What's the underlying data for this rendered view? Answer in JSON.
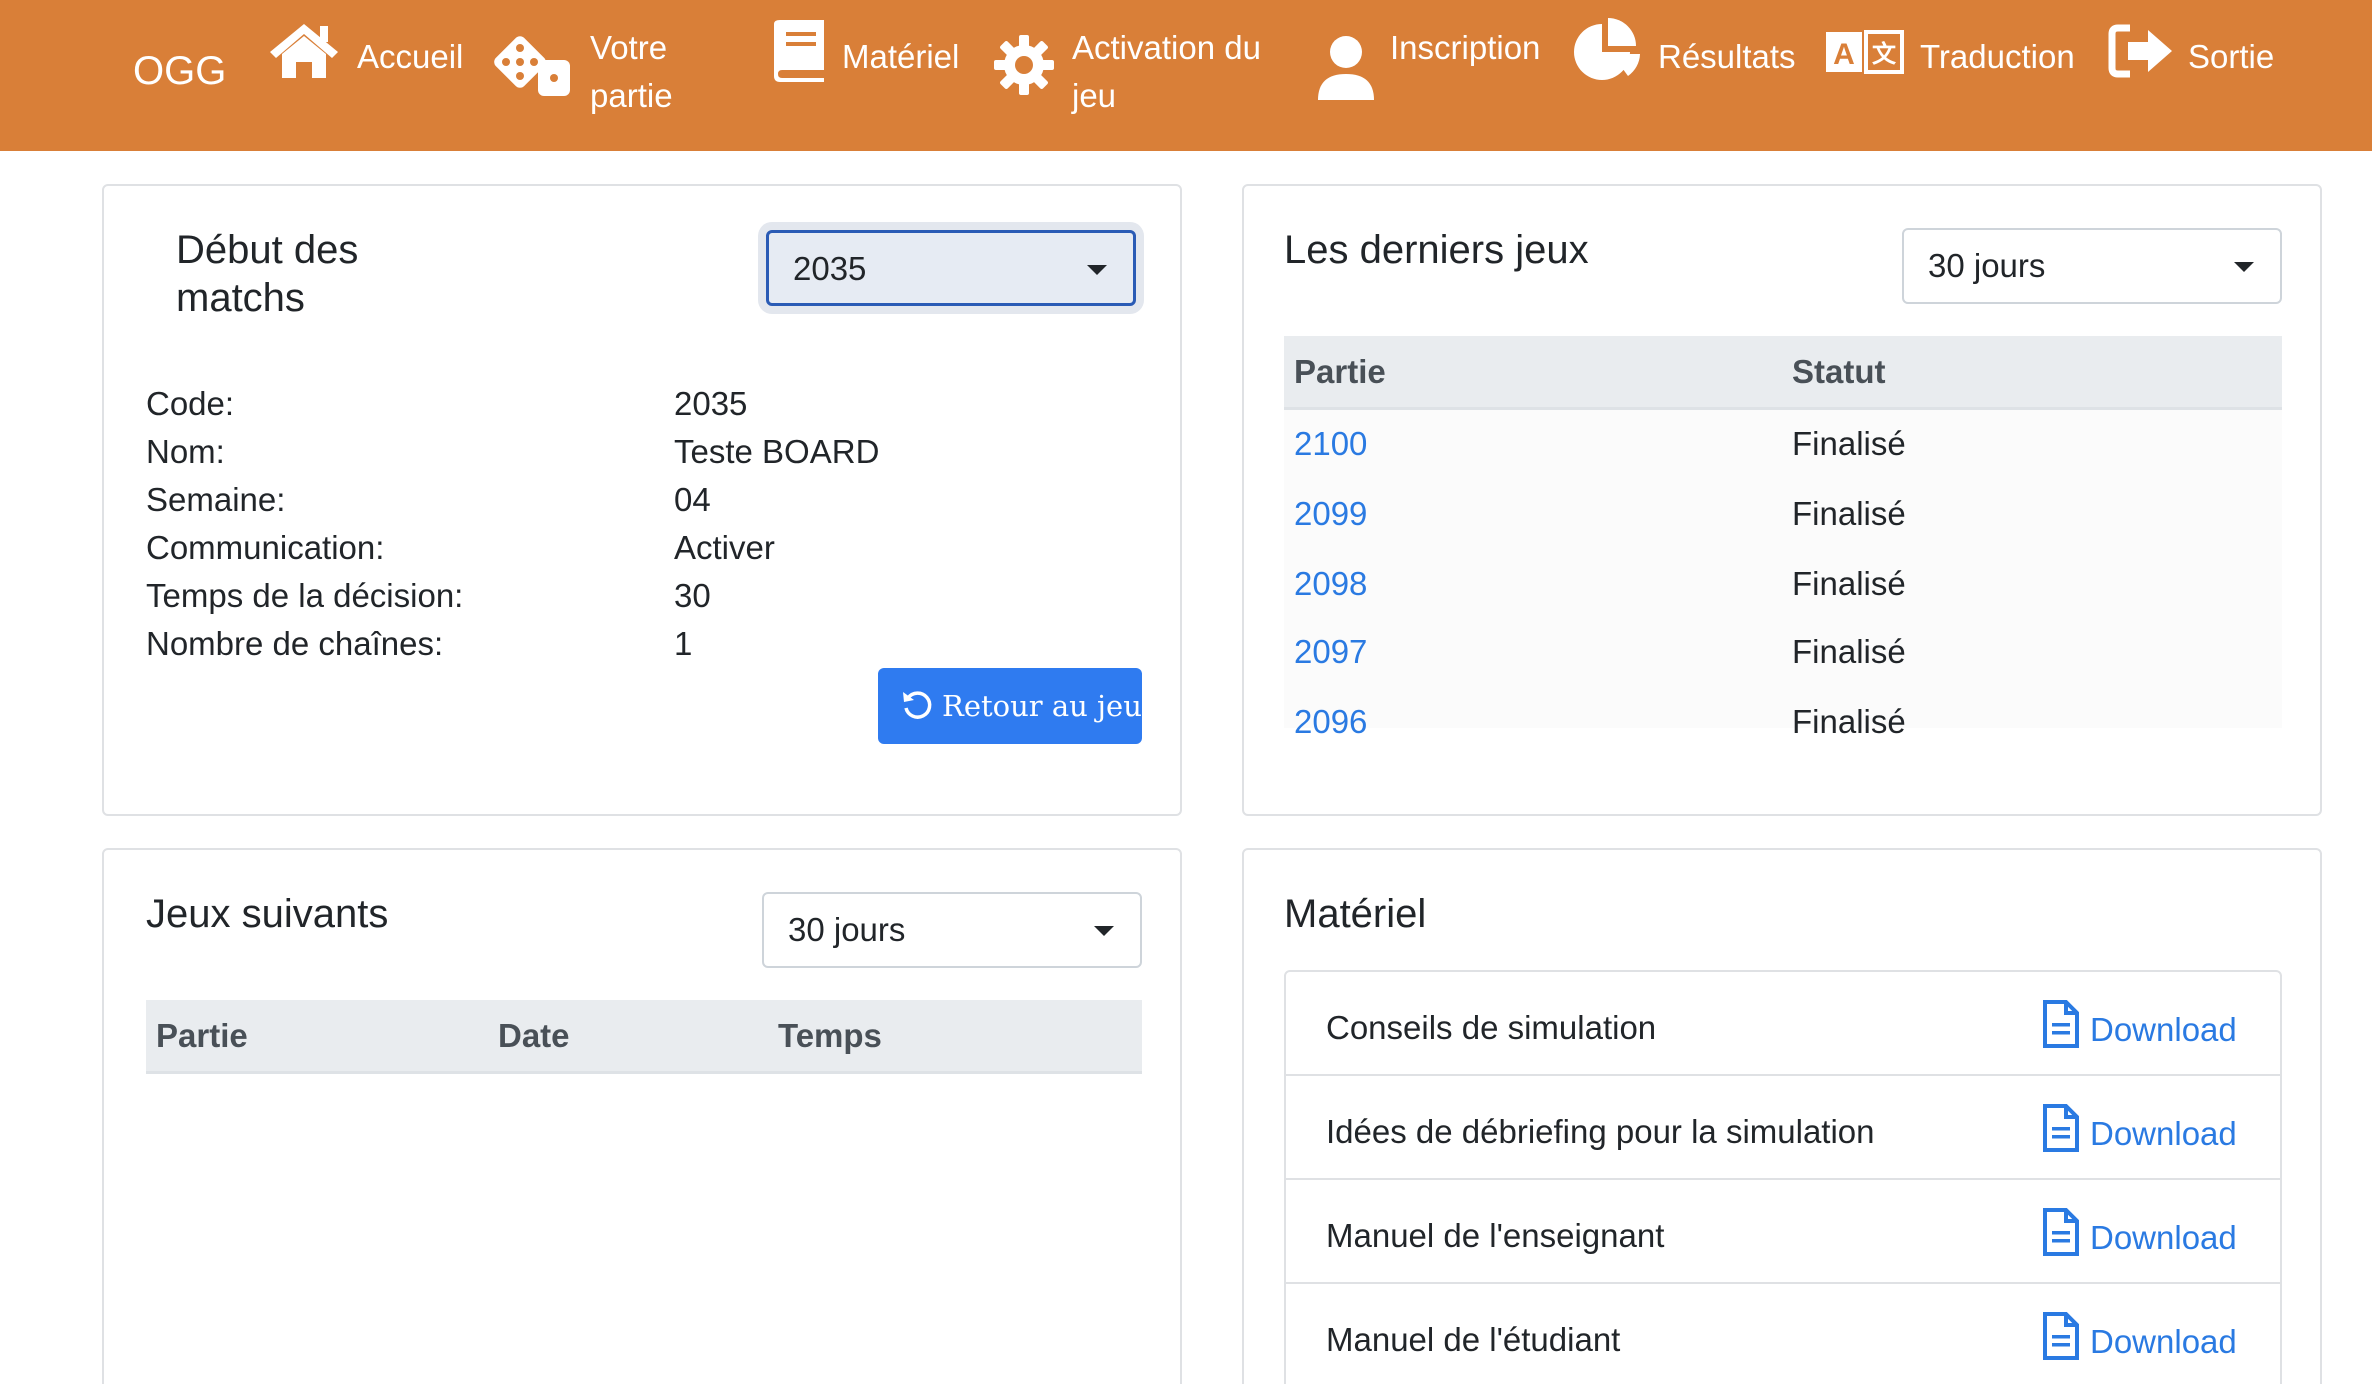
{
  "navbar": {
    "brand": "OGG",
    "items": [
      {
        "label": "Accueil",
        "icon": "home-icon"
      },
      {
        "label_line1": "Votre",
        "label_line2": "partie",
        "icon": "dice-icon"
      },
      {
        "label": "Matériel",
        "icon": "book-icon"
      },
      {
        "label_line1": "Activation du",
        "label_line2": "jeu",
        "icon": "gear-icon"
      },
      {
        "label": "Inscription",
        "icon": "user-icon"
      },
      {
        "label": "Résultats",
        "icon": "pie-chart-icon"
      },
      {
        "label": "Traduction",
        "icon": "language-icon"
      },
      {
        "label": "Sortie",
        "icon": "sign-out-icon"
      }
    ],
    "color": "#d97f38"
  },
  "match_start": {
    "title_line1": "Début des",
    "title_line2": "matchs",
    "select_value": "2035",
    "fields": [
      {
        "label": "Code:",
        "value": "2035"
      },
      {
        "label": "Nom:",
        "value": "Teste BOARD"
      },
      {
        "label": "Semaine:",
        "value": "04"
      },
      {
        "label": "Communication:",
        "value": "Activer"
      },
      {
        "label": "Temps de la décision:",
        "value": "30"
      },
      {
        "label": "Nombre de chaînes:",
        "value": "1"
      }
    ],
    "back_button": "Retour au jeu",
    "back_icon": "undo-icon"
  },
  "last_games": {
    "title": "Les derniers jeux",
    "select_value": "30 jours",
    "columns": [
      "Partie",
      "Statut"
    ],
    "rows": [
      {
        "game": "2100",
        "status": "Finalisé"
      },
      {
        "game": "2099",
        "status": "Finalisé"
      },
      {
        "game": "2098",
        "status": "Finalisé"
      },
      {
        "game": "2097",
        "status": "Finalisé"
      },
      {
        "game": "2096",
        "status": "Finalisé"
      }
    ]
  },
  "next_games": {
    "title": "Jeux suivants",
    "select_value": "30 jours",
    "columns": [
      "Partie",
      "Date",
      "Temps"
    ]
  },
  "material": {
    "title": "Matériel",
    "items": [
      {
        "label": "Conseils de simulation",
        "link": "Download"
      },
      {
        "label": "Idées de débriefing pour la simulation",
        "link": "Download"
      },
      {
        "label": "Manuel de l'enseignant",
        "link": "Download"
      },
      {
        "label": "Manuel de l'étudiant",
        "link": "Download"
      }
    ],
    "icon": "file-icon"
  },
  "colors": {
    "accent": "#d97f38",
    "primary_button": "#2f7bf0",
    "link": "#2a7ae2"
  }
}
